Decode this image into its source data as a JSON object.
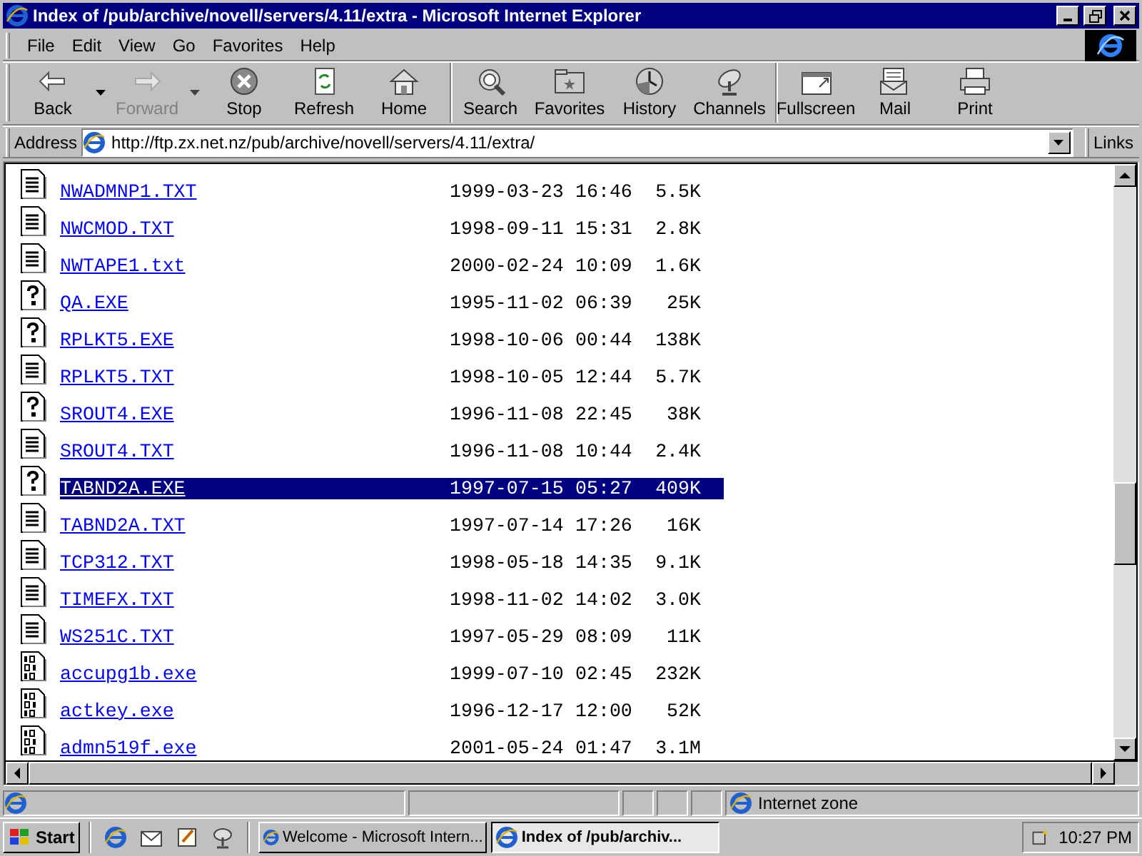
{
  "window": {
    "title": "Index of /pub/archive/novell/servers/4.11/extra - Microsoft Internet Explorer"
  },
  "menu": [
    "File",
    "Edit",
    "View",
    "Go",
    "Favorites",
    "Help"
  ],
  "toolbar": [
    {
      "label": "Back",
      "kind": "back",
      "dropdown": true,
      "disabled": false
    },
    {
      "label": "Forward",
      "kind": "forward",
      "dropdown": true,
      "disabled": true
    },
    {
      "label": "Stop",
      "kind": "stop",
      "dropdown": false,
      "disabled": false
    },
    {
      "label": "Refresh",
      "kind": "refresh",
      "dropdown": false,
      "disabled": false
    },
    {
      "label": "Home",
      "kind": "home",
      "dropdown": false,
      "disabled": false
    },
    {
      "label": "Search",
      "kind": "search",
      "dropdown": false,
      "disabled": false,
      "group_start": true
    },
    {
      "label": "Favorites",
      "kind": "favorites",
      "dropdown": false,
      "disabled": false
    },
    {
      "label": "History",
      "kind": "history",
      "dropdown": false,
      "disabled": false
    },
    {
      "label": "Channels",
      "kind": "channels",
      "dropdown": false,
      "disabled": false
    },
    {
      "label": "Fullscreen",
      "kind": "fullscreen",
      "dropdown": false,
      "disabled": false,
      "group_start": true
    },
    {
      "label": "Mail",
      "kind": "mail",
      "dropdown": false,
      "disabled": false
    },
    {
      "label": "Print",
      "kind": "print",
      "dropdown": false,
      "disabled": false
    }
  ],
  "address": {
    "label": "Address",
    "value": "http://ftp.zx.net.nz/pub/archive/novell/servers/4.11/extra/",
    "links": "Links"
  },
  "files": [
    {
      "name": "NWADMNP1.TXT",
      "date": "1999-03-23",
      "time": "16:46",
      "size": "5.5K",
      "kind": "text",
      "selected": false
    },
    {
      "name": "NWCMOD.TXT",
      "date": "1998-09-11",
      "time": "15:31",
      "size": "2.8K",
      "kind": "text",
      "selected": false
    },
    {
      "name": "NWTAPE1.txt",
      "date": "2000-02-24",
      "time": "10:09",
      "size": "1.6K",
      "kind": "text",
      "selected": false
    },
    {
      "name": "QA.EXE",
      "date": "1995-11-02",
      "time": "06:39",
      "size": "25K",
      "kind": "unknown",
      "selected": false
    },
    {
      "name": "RPLKT5.EXE",
      "date": "1998-10-06",
      "time": "00:44",
      "size": "138K",
      "kind": "unknown",
      "selected": false
    },
    {
      "name": "RPLKT5.TXT",
      "date": "1998-10-05",
      "time": "12:44",
      "size": "5.7K",
      "kind": "text",
      "selected": false
    },
    {
      "name": "SROUT4.EXE",
      "date": "1996-11-08",
      "time": "22:45",
      "size": "38K",
      "kind": "unknown",
      "selected": false
    },
    {
      "name": "SROUT4.TXT",
      "date": "1996-11-08",
      "time": "10:44",
      "size": "2.4K",
      "kind": "text",
      "selected": false
    },
    {
      "name": "TABND2A.EXE",
      "date": "1997-07-15",
      "time": "05:27",
      "size": "409K",
      "kind": "unknown",
      "selected": true
    },
    {
      "name": "TABND2A.TXT",
      "date": "1997-07-14",
      "time": "17:26",
      "size": "16K",
      "kind": "text",
      "selected": false
    },
    {
      "name": "TCP312.TXT",
      "date": "1998-05-18",
      "time": "14:35",
      "size": "9.1K",
      "kind": "text",
      "selected": false
    },
    {
      "name": "TIMEFX.TXT",
      "date": "1998-11-02",
      "time": "14:02",
      "size": "3.0K",
      "kind": "text",
      "selected": false
    },
    {
      "name": "WS251C.TXT",
      "date": "1997-05-29",
      "time": "08:09",
      "size": "11K",
      "kind": "text",
      "selected": false
    },
    {
      "name": "accupg1b.exe",
      "date": "1999-07-10",
      "time": "02:45",
      "size": "232K",
      "kind": "binary",
      "selected": false
    },
    {
      "name": "actkey.exe",
      "date": "1996-12-17",
      "time": "12:00",
      "size": "52K",
      "kind": "binary",
      "selected": false
    },
    {
      "name": "admn519f.exe",
      "date": "2001-05-24",
      "time": "01:47",
      "size": "3.1M",
      "kind": "binary",
      "selected": false
    }
  ],
  "status_bar": {
    "zone": "Internet zone"
  },
  "taskbar": {
    "start": "Start",
    "tasks": [
      {
        "label": "Welcome - Microsoft Intern...",
        "selected": false
      },
      {
        "label": "Index of /pub/archiv...",
        "selected": true
      }
    ],
    "clock": "10:27 PM"
  }
}
